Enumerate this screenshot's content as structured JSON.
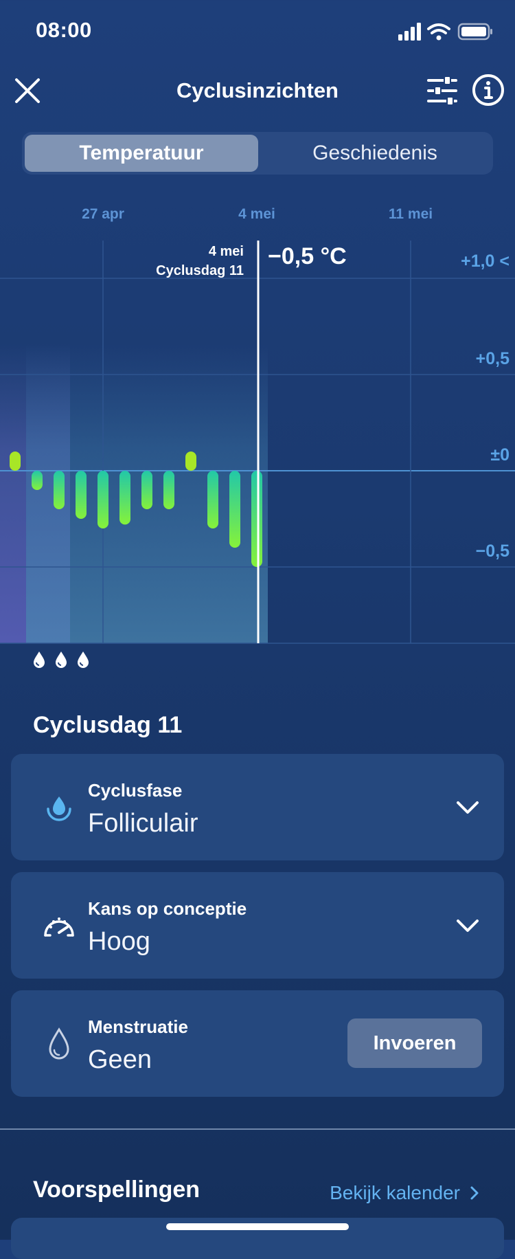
{
  "status": {
    "time": "08:00"
  },
  "header": {
    "title": "Cyclusinzichten"
  },
  "tabs": [
    {
      "label": "Temperatuur",
      "active": true
    },
    {
      "label": "Geschiedenis",
      "active": false
    }
  ],
  "chart": {
    "x_labels": [
      "27 apr",
      "4 mei",
      "11 mei"
    ],
    "y_labels": [
      "+1,0 <",
      "+0,5",
      "±0",
      "−0,5"
    ],
    "selected_date": "4 mei",
    "selected_cycle_day": "Cyclusdag 11",
    "selected_value": "−0,5 °C"
  },
  "chart_data": {
    "type": "bar",
    "unit": "°C",
    "ylim": [
      -0.9,
      1.1
    ],
    "y_ticks": [
      1.0,
      0.5,
      0,
      -0.5
    ],
    "x": [
      "23 apr",
      "24 apr",
      "25 apr",
      "26 apr",
      "27 apr",
      "28 apr",
      "29 apr",
      "30 apr",
      "1 mei",
      "2 mei",
      "3 mei",
      "4 mei"
    ],
    "values": [
      0.1,
      -0.1,
      -0.2,
      -0.25,
      -0.3,
      -0.28,
      -0.2,
      -0.2,
      0.1,
      -0.3,
      -0.4,
      -0.5
    ],
    "selected_index": 11,
    "period_days": 3,
    "colors": {
      "positive": "#a8e627",
      "negative_top": "#22c8a8",
      "negative_bottom": "#7ff03a"
    }
  },
  "section": {
    "title": "Cyclusdag 11"
  },
  "cards": [
    {
      "label": "Cyclusfase",
      "value": "Folliculair",
      "icon": "drop-filled-icon"
    },
    {
      "label": "Kans op conceptie",
      "value": "Hoog",
      "icon": "gauge-icon"
    },
    {
      "label": "Menstruatie",
      "value": "Geen",
      "icon": "drop-outline-icon",
      "button": "Invoeren"
    }
  ],
  "predictions": {
    "title": "Voorspellingen",
    "link": "Bekijk kalender"
  }
}
